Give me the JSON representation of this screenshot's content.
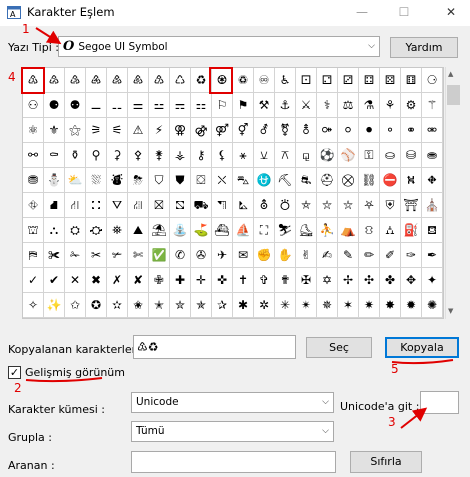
{
  "window": {
    "title": "Karakter Eşlem",
    "minimize_glyph": "—",
    "maximize_glyph": "☐",
    "close_glyph": "✕"
  },
  "font_row": {
    "label": "Yazı Tipi :",
    "font_symbol": "O",
    "selected_font": "Segoe UI Symbol",
    "help_button": "Yardım"
  },
  "symbol_grid": {
    "rows": [
      [
        "♳",
        "♴",
        "♵",
        "♶",
        "♷",
        "♸",
        "♹",
        "♺",
        "♻",
        "♼",
        "♽",
        "♾",
        "♿",
        "⚀",
        "⚁",
        "⚂",
        "⚃",
        "⚄",
        "⚅",
        "⚆"
      ],
      [
        "⚇",
        "⚈",
        "⚉",
        "⚊",
        "⚋",
        "⚌",
        "⚍",
        "⚎",
        "⚏",
        "⚐",
        "⚑",
        "⚒",
        "⚓",
        "⚔",
        "⚕",
        "⚖",
        "⚗",
        "⚘",
        "⚙",
        "⚚"
      ],
      [
        "⚛",
        "⚜",
        "⚝",
        "⚞",
        "⚟",
        "⚠",
        "⚡",
        "⚢",
        "⚣",
        "⚤",
        "⚥",
        "⚦",
        "⚧",
        "⚨",
        "⚩",
        "⚪",
        "⚫",
        "⚬",
        "⚭",
        "⚮"
      ],
      [
        "⚯",
        "⚰",
        "⚱",
        "⚲",
        "⚳",
        "⚴",
        "⚵",
        "⚶",
        "⚷",
        "⚸",
        "⚹",
        "⚺",
        "⚻",
        "⚼",
        "⚽",
        "⚾",
        "⚿",
        "⛀",
        "⛁",
        "⛂"
      ],
      [
        "⛃",
        "⛄",
        "⛅",
        "⛆",
        "⛇",
        "⛈",
        "⛉",
        "⛊",
        "⛋",
        "⛌",
        "⛍",
        "⛎",
        "⛏",
        "⛐",
        "⛑",
        "⛒",
        "⛓",
        "⛔",
        "⛕",
        "⛖"
      ],
      [
        "⛗",
        "⛘",
        "⛙",
        "⛚",
        "⛛",
        "⛜",
        "⛝",
        "⛞",
        "⛟",
        "⛠",
        "⛡",
        "⛢",
        "⛣",
        "⛤",
        "⛥",
        "⛦",
        "⛧",
        "⛨",
        "⛩",
        "⛪"
      ],
      [
        "⛫",
        "⛬",
        "⛭",
        "⛮",
        "⛯",
        "⛰",
        "⛱",
        "⛲",
        "⛳",
        "⛴",
        "⛵",
        "⛶",
        "⛷",
        "⛸",
        "⛹",
        "⛺",
        "⛻",
        "⛼",
        "⛽",
        "⛾"
      ],
      [
        "⛿",
        "✀",
        "✁",
        "✂",
        "✃",
        "✄",
        "✅",
        "✆",
        "✇",
        "✈",
        "✉",
        "✊",
        "✋",
        "✌",
        "✍",
        "✎",
        "✏",
        "✐",
        "✑",
        "✒"
      ],
      [
        "✓",
        "✔",
        "✕",
        "✖",
        "✗",
        "✘",
        "✙",
        "✚",
        "✛",
        "✜",
        "✝",
        "✞",
        "✟",
        "✠",
        "✡",
        "✢",
        "✣",
        "✤",
        "✥",
        "✦"
      ],
      [
        "✧",
        "✨",
        "✩",
        "✪",
        "✫",
        "✬",
        "✭",
        "✮",
        "✯",
        "✰",
        "✱",
        "✲",
        "✳",
        "✴",
        "✵",
        "✶",
        "✷",
        "✸",
        "✹",
        "✺"
      ]
    ]
  },
  "copy_row": {
    "label": "Kopyalanan karakterler :",
    "value": "♳♻",
    "select_button": "Seç",
    "copy_button": "Kopyala"
  },
  "advanced": {
    "checkbox_label": "Gelişmiş görünüm",
    "checked": true,
    "charset_label": "Karakter kümesi :",
    "charset_value": "Unicode",
    "goto_label": "Unicode'a git :",
    "goto_value": "",
    "group_label": "Grupla :",
    "group_value": "Tümü",
    "search_label": "Aranan :",
    "search_value": "",
    "search_button": "Sıfırla"
  },
  "annotations": {
    "n1": "1",
    "n2": "2",
    "n3": "3",
    "n4": "4",
    "n5": "5",
    "color": "#e00000"
  }
}
